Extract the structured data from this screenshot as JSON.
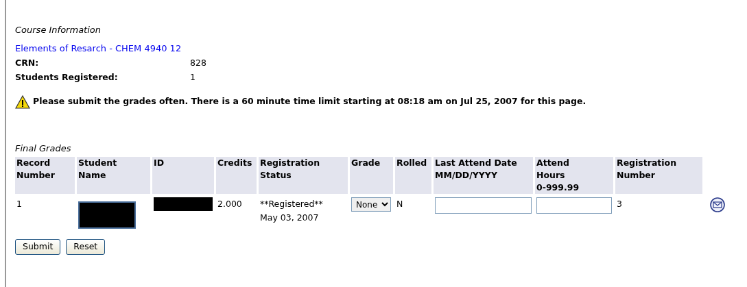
{
  "course_info": {
    "heading": "Course Information",
    "course_link": "Elements of Resarch - CHEM 4940 12",
    "fields": [
      {
        "label": "CRN:",
        "value": "828"
      },
      {
        "label": "Students Registered:",
        "value": "1"
      }
    ]
  },
  "warning": "Please submit the grades often. There is a 60 minute time limit starting at 08:18 am on Jul 25, 2007 for this page.",
  "final_grades": {
    "heading": "Final Grades",
    "columns": [
      [
        "Record",
        "Number"
      ],
      [
        "Student",
        "Name"
      ],
      [
        "ID"
      ],
      [
        "Credits"
      ],
      [
        "Registration",
        "Status"
      ],
      [
        "Grade"
      ],
      [
        "Rolled"
      ],
      [
        "Last Attend Date",
        "MM/DD/YYYY"
      ],
      [
        "Attend",
        "Hours",
        "0-999.99"
      ],
      [
        "Registration",
        "Number"
      ]
    ],
    "rows": [
      {
        "record_number": "1",
        "credits": "2.000",
        "registration_status": [
          "**Registered**",
          "May 03, 2007"
        ],
        "grade": "None",
        "rolled": "N",
        "registration_number": "3"
      }
    ]
  },
  "buttons": [
    "Submit",
    "Reset"
  ]
}
